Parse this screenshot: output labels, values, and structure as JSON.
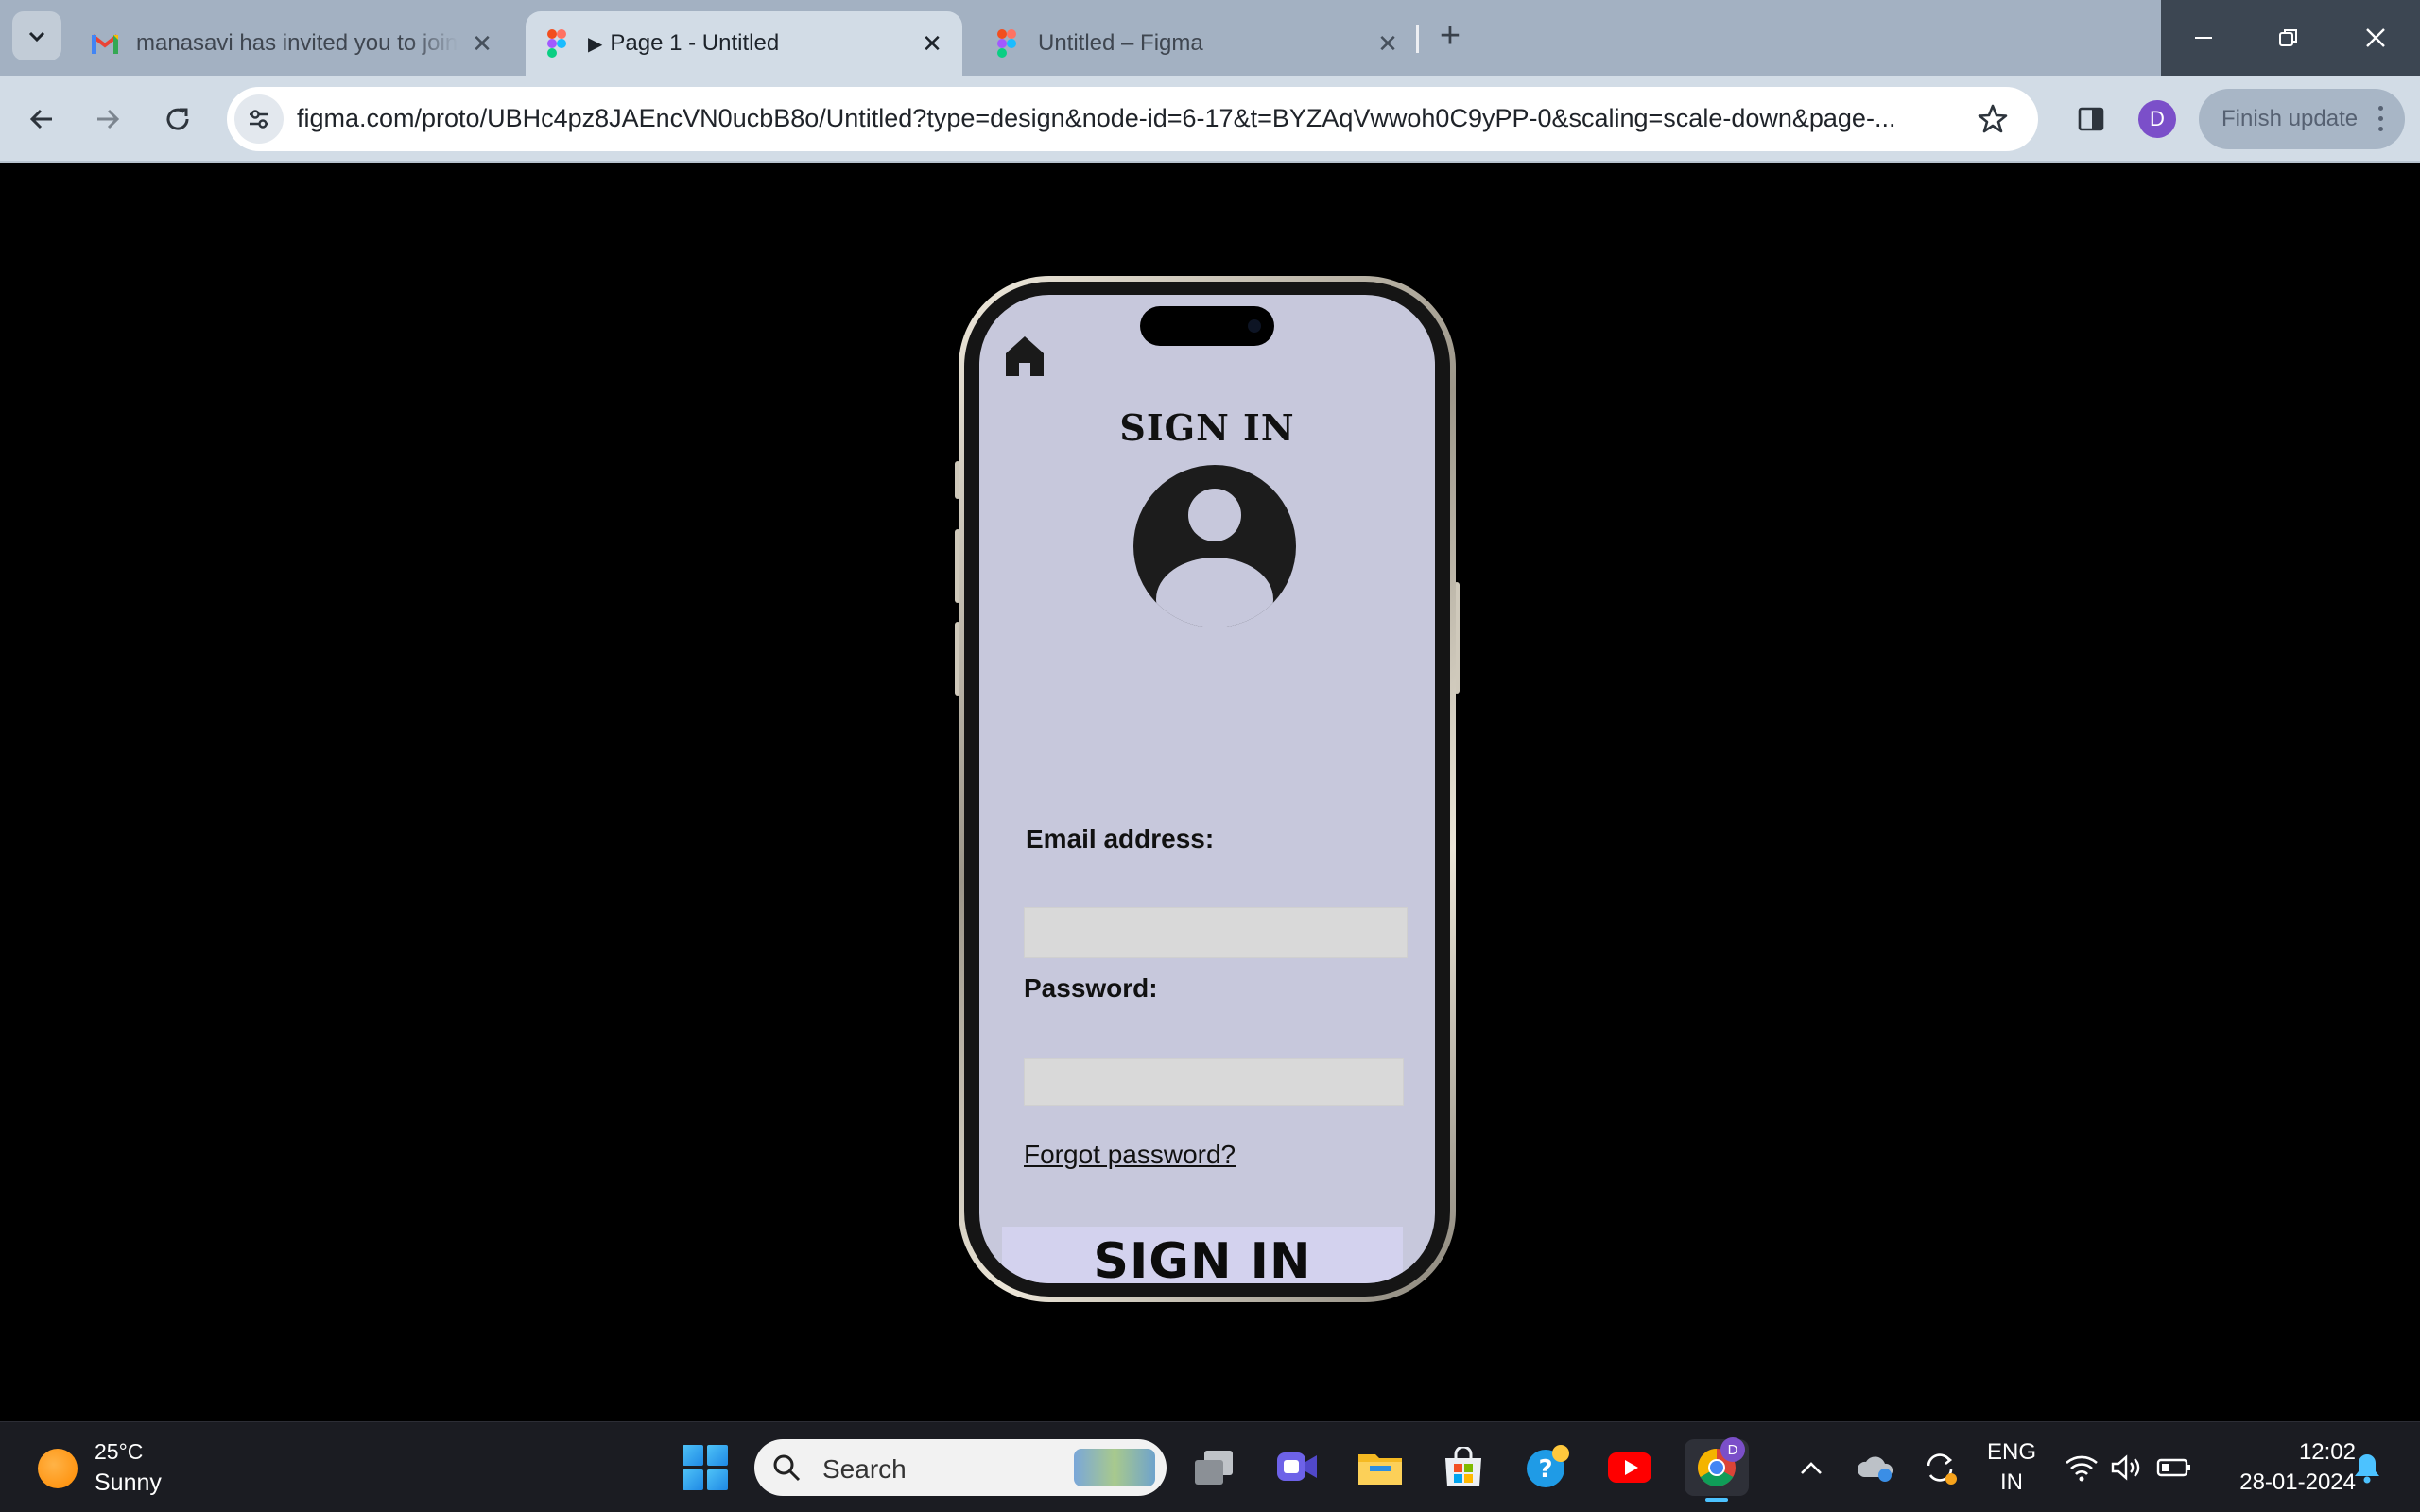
{
  "browser": {
    "tabs": [
      {
        "title": "manasavi has invited you to join",
        "favicon": "gmail-icon"
      },
      {
        "title": "Page 1 - Untitled",
        "favicon": "figma-icon",
        "active": true
      },
      {
        "title": "Untitled – Figma",
        "favicon": "figma-icon"
      }
    ],
    "new_tab_label": "+",
    "url": "figma.com/proto/UBHc4pz8JAEncVN0ucbB8o/Untitled?type=design&node-id=6-17&t=BYZAqVwwoh0C9yPP-0&scaling=scale-down&page-...",
    "profile_initial": "D",
    "finish_update_label": "Finish update",
    "colors": {
      "tabstrip": "#a3b1c2",
      "toolbar": "#d2dce6",
      "profile": "#7b4fc9"
    }
  },
  "prototype": {
    "title": "SIGN IN",
    "email_label": "Email address:",
    "email_value": "",
    "password_label": "Password:",
    "password_value": "",
    "forgot_link": "Forgot password?",
    "submit_label": "SIGN IN",
    "colors": {
      "screen_bg": "#c7c8dc",
      "field_bg": "#d9d9d9",
      "button_bg": "#d3d2ee"
    }
  },
  "taskbar": {
    "weather_temp": "25°C",
    "weather_cond": "Sunny",
    "search_placeholder": "Search",
    "lang_line1": "ENG",
    "lang_line2": "IN",
    "time": "12:02",
    "date": "28-01-2024",
    "chrome_badge": "D"
  }
}
